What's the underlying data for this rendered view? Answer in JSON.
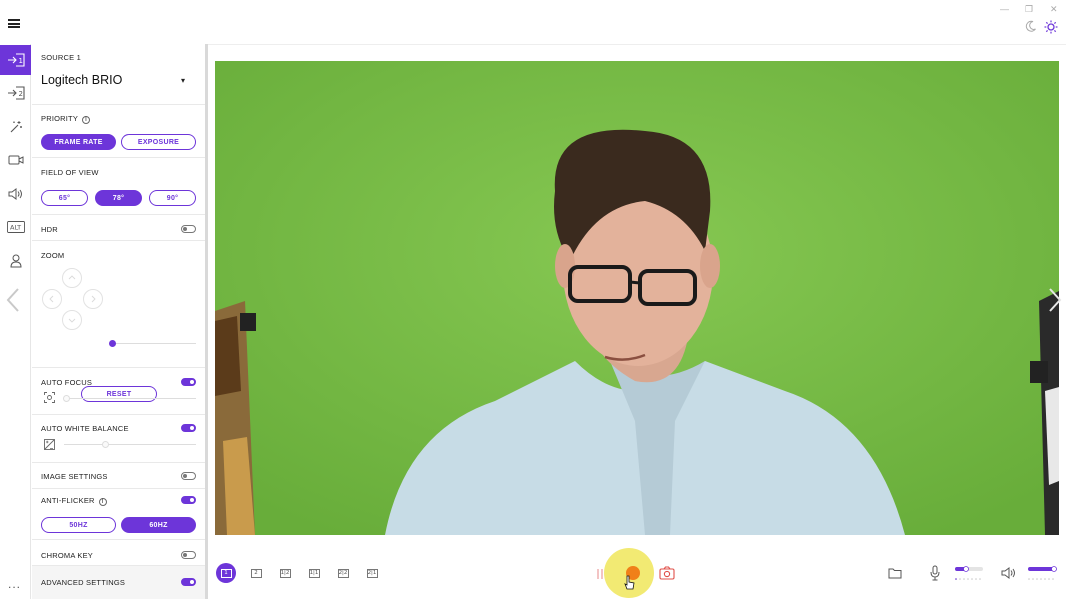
{
  "topbar": {
    "minimize": "—",
    "restore": "❐",
    "close": "✕"
  },
  "sidebar": {
    "items": [
      {
        "icon": "source-1-icon",
        "glyph": "1"
      },
      {
        "icon": "source-2-icon",
        "glyph": "2"
      },
      {
        "icon": "magic-wand-icon"
      },
      {
        "icon": "camera-icon"
      },
      {
        "icon": "speaker-icon"
      },
      {
        "icon": "alt-icon",
        "glyph": "ALT"
      },
      {
        "icon": "user-icon"
      }
    ],
    "more": "..."
  },
  "panel": {
    "source_label": "SOURCE 1",
    "camera": "Logitech BRIO",
    "priority": {
      "label": "PRIORITY",
      "options": [
        "FRAME RATE",
        "EXPOSURE"
      ],
      "selected": "FRAME RATE"
    },
    "fov": {
      "label": "FIELD OF VIEW",
      "options": [
        "65°",
        "78°",
        "90°"
      ],
      "selected": "78°"
    },
    "hdr": {
      "label": "HDR",
      "on": false
    },
    "zoom": {
      "label": "ZOOM",
      "reset": "RESET",
      "level": 0
    },
    "auto_focus": {
      "label": "AUTO FOCUS",
      "on": true
    },
    "auto_white_balance": {
      "label": "AUTO WHITE BALANCE",
      "on": true
    },
    "image_settings": {
      "label": "IMAGE SETTINGS",
      "on": false
    },
    "anti_flicker": {
      "label": "ANTI-FLICKER",
      "on": true,
      "options": [
        "50HZ",
        "60HZ"
      ],
      "selected": "60HZ"
    },
    "chroma_key": {
      "label": "CHROMA KEY",
      "on": false
    },
    "advanced": {
      "label": "ADVANCED SETTINGS",
      "on": true
    }
  },
  "toolbar": {
    "layouts": [
      "1",
      "2",
      "1|2",
      "1|1",
      "2|2",
      "2|1"
    ],
    "selected_layout": "1"
  },
  "colors": {
    "accent": "#6d35d9",
    "record": "#f08019",
    "screen": "#79bb45"
  }
}
